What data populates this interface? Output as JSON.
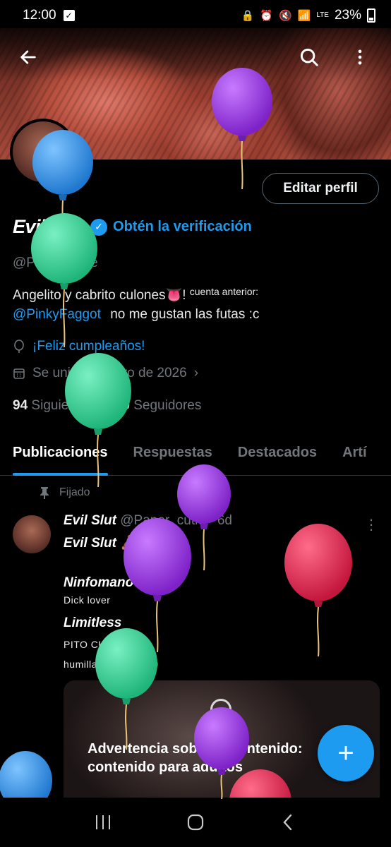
{
  "status_bar": {
    "time": "12:00",
    "battery": "23%",
    "network": "LTE"
  },
  "header": {
    "back_icon": "arrow-left-icon",
    "search_icon": "search-icon",
    "more_icon": "more-vertical-icon"
  },
  "profile": {
    "edit_button": "Editar perfil",
    "display_name": "Evil Slut",
    "verify_link": "Obtén la verificación",
    "handle": "@Paper_cutie",
    "bio_line1_main": "Angelito y cabrito culones",
    "bio_line1_emoji": "👅",
    "bio_line1_bang": "!",
    "bio_line1_small": "cuenta anterior:",
    "bio_mention": "@PinkyFaggot",
    "bio_line2_rest": "no me gustan las futas :c",
    "birthday": "¡Feliz cumpleaños!",
    "joined": "Se unió en enero de 2026",
    "following_count": "94",
    "following_label": "Siguiendo",
    "followers_count": "450",
    "followers_label": "Seguidores"
  },
  "tabs": [
    {
      "label": "Publicaciones",
      "active": true
    },
    {
      "label": "Respuestas",
      "active": false
    },
    {
      "label": "Destacados",
      "active": false
    },
    {
      "label": "Artí",
      "active": false
    }
  ],
  "post": {
    "pinned_label": "Fijado",
    "author": "Evil Slut",
    "handle": "@Paper_cutie",
    "time": "· 6d",
    "line1": "Evil Slut 🧸",
    "line2": "Ninfomano",
    "line3": "Dick lover",
    "line4": "Limitless",
    "line5": "PITO CHICO! 💔",
    "line6": "humillatiom lover 🥴",
    "warning_title": "Advertencia sobre el contenido: contenido para adultos"
  },
  "fab": {
    "icon": "plus-icon",
    "label": "+"
  },
  "nav": {
    "recent_icon": "recents-icon",
    "home_icon": "home-icon",
    "back_icon": "back-icon"
  },
  "colors": {
    "accent": "#1d9bf0",
    "muted": "#71767b",
    "balloon_blue": "#3b9be8",
    "balloon_green": "#2fd89a",
    "balloon_purple": "#9b35e0",
    "balloon_red": "#e0284e"
  }
}
